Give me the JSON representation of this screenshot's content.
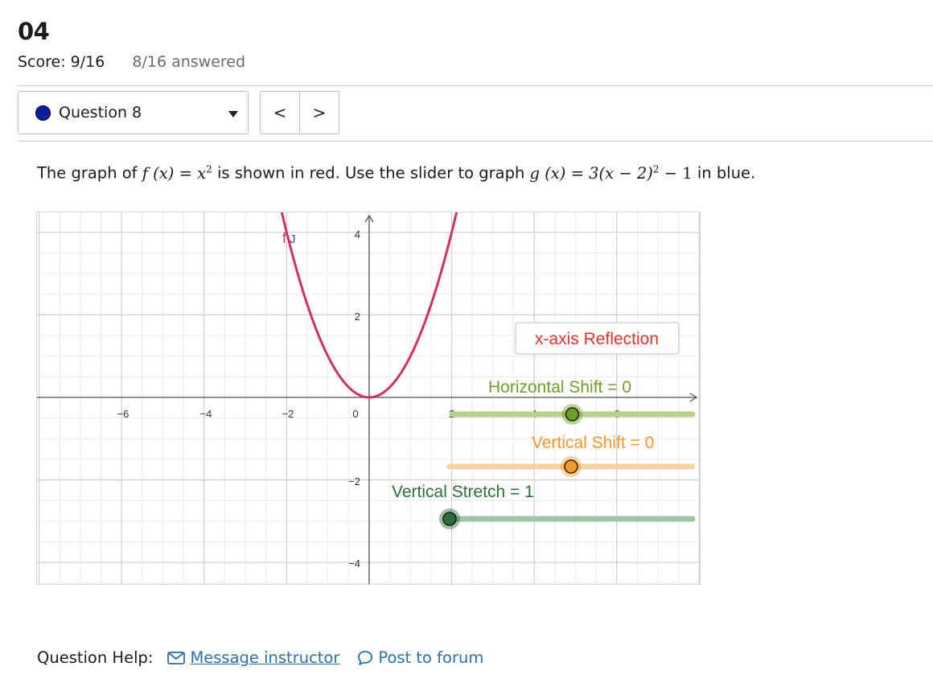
{
  "assignment": {
    "title": "04",
    "score": "Score: 9/16",
    "answered": "8/16 answered"
  },
  "question_select": {
    "label": "Question 8",
    "status_color": "#0a1e9e"
  },
  "nav": {
    "prev": "<",
    "next": ">"
  },
  "problem": {
    "lead": "The graph of",
    "f_expr": "f (x) = x",
    "f_exp": "2",
    "mid": "is shown in red. Use the slider to graph",
    "g_expr_a": "g (x) = 3(x − 2)",
    "g_exp": "2",
    "g_expr_b": "− 1",
    "tail": "in blue."
  },
  "graph": {
    "x_ticks": [
      "−6",
      "−4",
      "−2",
      "0",
      "2",
      "4",
      "6"
    ],
    "y_ticks": [
      "4",
      "2",
      "−2",
      "−4"
    ],
    "curve_label": "f",
    "colors": {
      "curve": "#d0315d",
      "horizontal": "#6f9e2a",
      "vertical": "#f0992c",
      "stretch": "#2d6e3a",
      "reflection": "#e3332b"
    },
    "reflection_button": "x-axis Reflection",
    "sliders": {
      "horizontal": {
        "label": "Horizontal Shift = 0",
        "value": 0,
        "knob_fraction": 0.5
      },
      "vertical": {
        "label": "Vertical Shift = 0",
        "value": 0,
        "knob_fraction": 0.5
      },
      "stretch": {
        "label": "Vertical Stretch = 1",
        "value": 1,
        "knob_fraction": 0.0
      }
    }
  },
  "help": {
    "label": "Question Help:",
    "message": "Message instructor",
    "forum": "Post to forum"
  }
}
